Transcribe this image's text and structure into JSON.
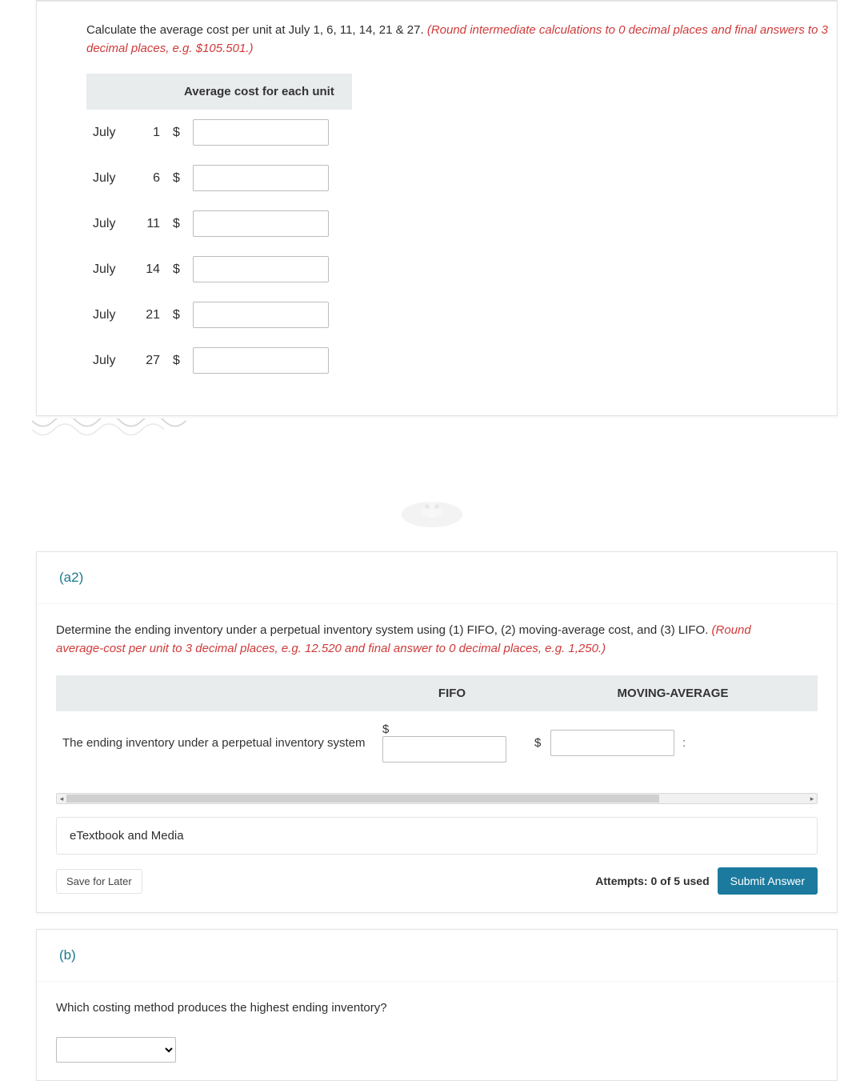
{
  "section_a1": {
    "prompt_black": "Calculate the average cost per unit at July 1, 6, 11, 14, 21 & 27. ",
    "prompt_red": "(Round intermediate calculations to 0 decimal places and final answers to 3 decimal places, e.g. $105.501.)",
    "header": "Average cost for each unit",
    "month": "July",
    "currency": "$",
    "rows": [
      {
        "day": "1"
      },
      {
        "day": "6"
      },
      {
        "day": "11"
      },
      {
        "day": "14"
      },
      {
        "day": "21"
      },
      {
        "day": "27"
      }
    ]
  },
  "section_a2": {
    "label": "(a2)",
    "prompt_black": "Determine the ending inventory under a perpetual inventory system using (1) FIFO, (2) moving-average cost, and (3) LIFO. ",
    "prompt_red": "(Round average-cost per unit to 3 decimal places, e.g. 12.520 and final answer to 0 decimal places, e.g. 1,250.)",
    "col1": "FIFO",
    "col2": "MOVING-AVERAGE",
    "row_label": "The ending inventory under a perpetual inventory system",
    "currency": "$",
    "etextbook": "eTextbook and Media",
    "save": "Save for Later",
    "attempts": "Attempts: 0 of 5 used",
    "submit": "Submit Answer"
  },
  "section_b": {
    "label": "(b)",
    "prompt": "Which costing method produces the highest ending inventory?"
  }
}
